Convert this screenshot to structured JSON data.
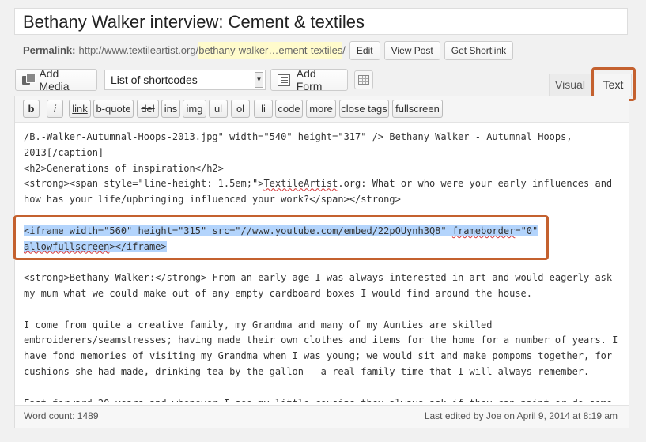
{
  "post": {
    "title": "Bethany Walker interview: Cement & textiles"
  },
  "permalink": {
    "label": "Permalink:",
    "base_url": "http://www.textileartist.org/",
    "slug": "bethany-walker…ement-textiles",
    "trailing": "/",
    "edit_label": "Edit",
    "view_post_label": "View Post",
    "get_shortlink_label": "Get Shortlink"
  },
  "media_toolbar": {
    "add_media_label": "Add Media",
    "shortcodes_selected": "List of shortcodes",
    "add_form_label": "Add Form"
  },
  "editor_tabs": {
    "visual": "Visual",
    "text": "Text",
    "active": "Text"
  },
  "quicktags": [
    "b",
    "i",
    "link",
    "b-quote",
    "del",
    "ins",
    "img",
    "ul",
    "ol",
    "li",
    "code",
    "more",
    "close tags",
    "fullscreen"
  ],
  "content": {
    "line_1": "/B.-Walker-Autumnal-Hoops-2013.jpg\" width=\"540\" height=\"317\" /> Bethany Walker - Autumnal Hoops,",
    "line_2": "2013[/caption]",
    "line_3": "<h2>Generations of inspiration</h2>",
    "line_4a": "<strong><span style=\"line-height: 1.5em;\">",
    "line_4b": "TextileArtist",
    "line_4c": ".org: What or who were your early influences and",
    "line_5": "how has your life/upbringing influenced your work?</span></strong>",
    "line_6": "",
    "iframe_1a": "<iframe width=\"560\" height=\"315\" src=\"//www.youtube.com/embed/22pOUynh3Q8\" ",
    "iframe_1b": "frameborder",
    "iframe_1c": "=\"0\"",
    "iframe_2a": "allowfullscreen",
    "iframe_2b": "></iframe>",
    "line_9": "",
    "line_10": "<strong>Bethany Walker:</strong> From an early age I was always interested in art and would eagerly ask",
    "line_11": "my mum what we could make out of any empty cardboard boxes I would find around the house.",
    "line_12": "",
    "line_13": "I come from quite a creative family, my Grandma and many of my Aunties are skilled",
    "line_14": "embroiderers/seamstresses; having made their own clothes and items for the home for a number of years. I",
    "line_15": "have fond memories of visiting my Grandma when I was young; we would sit and make pompoms together, for",
    "line_16": "cushions she had made, drinking tea by the gallon – a real family time that I will always remember.",
    "line_17": "",
    "line_18": "Fast forward 20 years and whenever I see my little cousins they always ask if they can paint or do some"
  },
  "status": {
    "word_count": "Word count: 1489",
    "last_edited": "Last edited by Joe on April 9, 2014 at 8:19 am"
  }
}
